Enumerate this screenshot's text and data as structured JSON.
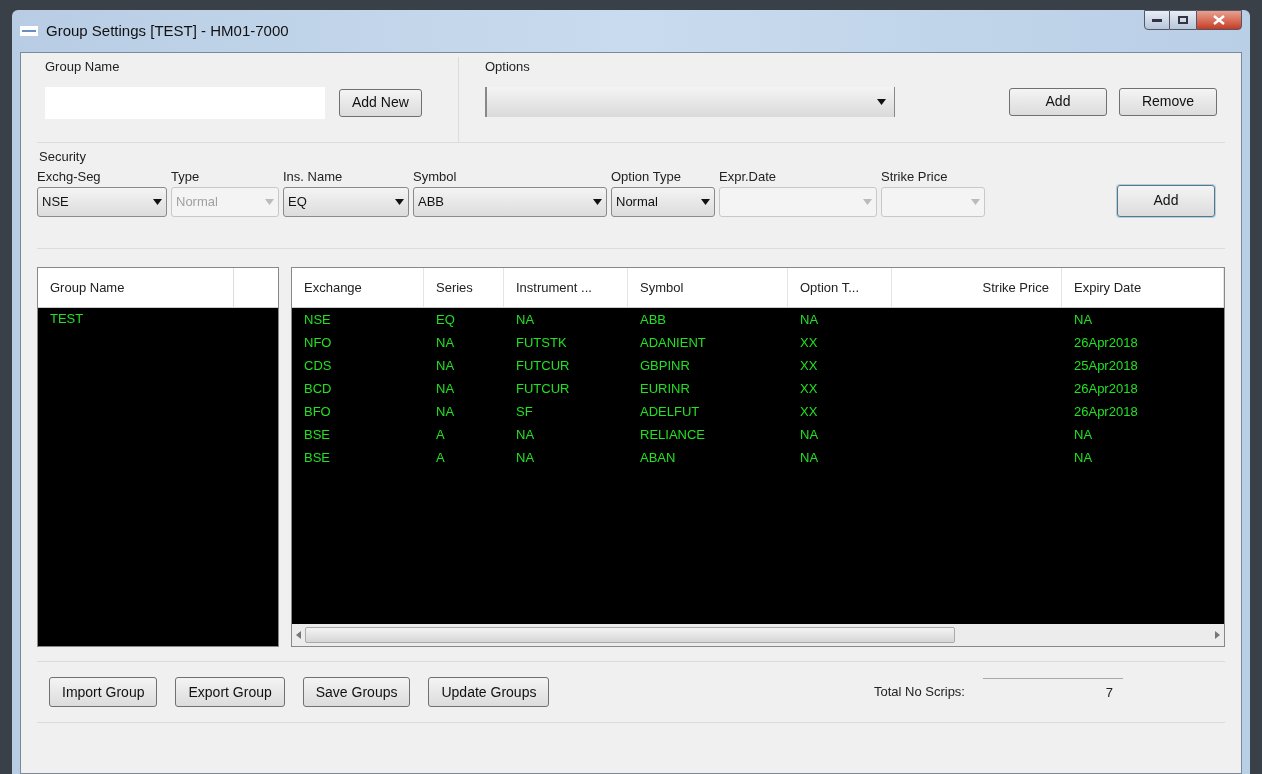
{
  "window": {
    "title": "Group Settings [TEST] - HM01-7000"
  },
  "group_name": {
    "label": "Group Name",
    "button": "Add New"
  },
  "options": {
    "label": "Options",
    "buttons": [
      "Add",
      "Remove"
    ]
  },
  "security": {
    "label": "Security",
    "fields": [
      {
        "label": "Exchg-Seg",
        "value": "NSE",
        "disabled": false
      },
      {
        "label": "Type",
        "value": "Normal",
        "disabled": true
      },
      {
        "label": "Ins. Name",
        "value": "EQ",
        "disabled": false
      },
      {
        "label": "Symbol",
        "value": "ABB",
        "disabled": false
      },
      {
        "label": "Option Type",
        "value": "Normal",
        "disabled": false
      },
      {
        "label": "Expr.Date",
        "disabled": true
      },
      {
        "label": "Strike Price",
        "disabled": true
      }
    ],
    "button": "Add"
  },
  "groups": {
    "column": "Group Name",
    "rows": [
      {
        "name": "TEST",
        "selected": false
      }
    ]
  },
  "table": {
    "columns": [
      "Exchange",
      "Series",
      "Instrument ...",
      "Symbol",
      "Option T...",
      "Strike Price",
      "Expiry Date"
    ],
    "rows": [
      [
        "NSE",
        "EQ",
        "NA",
        "ABB",
        "NA",
        "",
        "NA"
      ],
      [
        "NFO",
        "NA",
        "FUTSTK",
        "ADANIENT",
        "XX",
        "",
        "26Apr2018"
      ],
      [
        "CDS",
        "NA",
        "FUTCUR",
        "GBPINR",
        "XX",
        "",
        "25Apr2018"
      ],
      [
        "BCD",
        "NA",
        "FUTCUR",
        "EURINR",
        "XX",
        "",
        "26Apr2018"
      ],
      [
        "BFO",
        "NA",
        "SF",
        "ADELFUT",
        "XX",
        "",
        "26Apr2018"
      ],
      [
        "BSE",
        "A",
        "NA",
        "RELIANCE",
        "NA",
        "",
        "NA"
      ],
      [
        "BSE",
        "A",
        "NA",
        "ABAN",
        "NA",
        "",
        "NA"
      ]
    ]
  },
  "footer": {
    "buttons": [
      "Import Group",
      "Export Group",
      "Save Groups",
      "Update Groups"
    ],
    "total_label": "Total No Scrips:",
    "total_value": "7"
  }
}
